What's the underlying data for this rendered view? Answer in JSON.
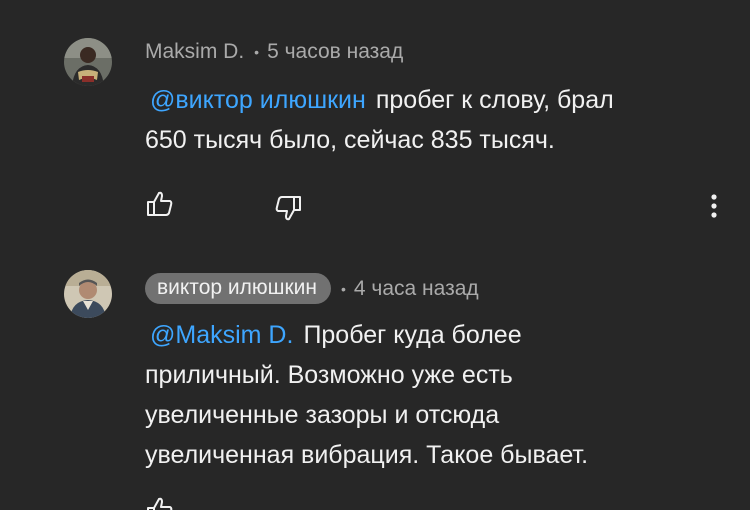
{
  "comments": [
    {
      "author": "Maksim D.",
      "time": "5 часов назад",
      "mention": "@виктор илюшкин",
      "line1": "пробег к слову, брал",
      "line2": "650 тысяч было, сейчас 835 тысяч."
    },
    {
      "author": "виктор илюшкин",
      "time": "4 часа назад",
      "mention": "@Maksim D.",
      "line1": "Пробег куда более",
      "line2": "приличный. Возможно уже есть",
      "line3": "увеличенные зазоры и отсюда",
      "line4": "увеличенная вибрация. Такое бывает."
    }
  ],
  "separator": "•",
  "colors": {
    "background": "#272727",
    "mention": "#3ea6ff",
    "meta_text": "#aaaaaa",
    "author_chip": "#717171"
  },
  "icons": [
    "like-icon",
    "dislike-icon",
    "more-vert-icon"
  ]
}
